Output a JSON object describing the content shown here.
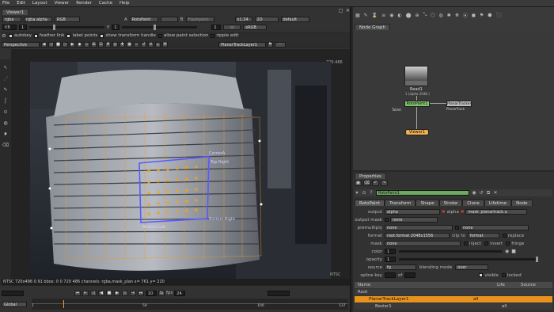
{
  "menu": [
    "File",
    "Edit",
    "Layout",
    "Viewer",
    "Render",
    "Cache",
    "Help"
  ],
  "viewer_tab": "Viewer1",
  "toolbar1": {
    "channels": "rgba",
    "layer": "rgba.alpha",
    "colorspace": "RGB",
    "a_label": "A",
    "a_input": "RotoPaint",
    "b_label": "B",
    "b_input": "Flashpoint",
    "zoom": "x1.34",
    "view_mode": "2D",
    "lut": "default"
  },
  "toolbar2": {
    "frame_field": "f/8",
    "range_a": "1",
    "y_label": "Y",
    "y_value": "1",
    "frame_num": "1",
    "lut2": "sRGB"
  },
  "roto_toolbar": {
    "autokey": "autokey",
    "feather_link": "feather link",
    "label_points": "label points",
    "show_handle": "show transform handle",
    "allow_paint": "allow paint selection",
    "ripple_edit": "ripple edit"
  },
  "tool_bar": {
    "view": "Perspective",
    "layer": "PlanarTrackLayer1"
  },
  "viewer": {
    "top_right_label": "720.486",
    "bottom_right_label": "NTSC",
    "status": "NTSC 720x486 0.91 bbox: 0 0 720 486 channels: rgba,mask_plan x= 761 y= 220",
    "corner_labels": [
      "CornerA",
      "Top Right",
      "Bottom Right",
      "Bottom Left"
    ]
  },
  "timeline": {
    "frame": "10",
    "fps_label": "fps",
    "fps": "24",
    "scope": "Global",
    "ticks": [
      "1",
      "50",
      "100",
      "137"
    ],
    "start": "1",
    "end": "137"
  },
  "node_graph": {
    "tab": "Node Graph",
    "nodes": {
      "read": "Read1",
      "read_sub": "1 (alpha 2048 )",
      "roto": "RotoPaint1",
      "roto_sub": "Tablet",
      "tracker": "PlanarTracker1",
      "tracker_sub": "PlanarTrack",
      "viewer": "Viewer1"
    }
  },
  "properties": {
    "tab": "Properties",
    "node_name": "RotoPaint1",
    "tabs": [
      "RotoPaint",
      "Transform",
      "Shape",
      "Stroke",
      "Clone",
      "Lifetime",
      "Node"
    ],
    "rows": [
      {
        "label": "output",
        "v1": "alpha",
        "v2": "alpha",
        "v3": "mask_planartrack.a"
      },
      {
        "label": "output mask",
        "v1": "none"
      },
      {
        "label": "premultiply",
        "v1": "none",
        "v2": "none"
      },
      {
        "label": "format",
        "v1": "root.format 2048x1556",
        "v2": "clip to",
        "v3": "format",
        "v4": "replace"
      },
      {
        "label": "mask",
        "v1": "none",
        "v2": "inject",
        "v3": "invert",
        "v4": "fringe"
      },
      {
        "label": "color",
        "v1": "1"
      },
      {
        "label": "opacity",
        "v1": "1"
      },
      {
        "label": "source",
        "v1": "fg",
        "v2": "blending mode",
        "v3": "over"
      },
      {
        "label": "spline key",
        "v1": "of",
        "v2": "visible",
        "v3": "locked"
      }
    ],
    "tree_headers": [
      "Name",
      "Life",
      "Source"
    ],
    "tree": [
      {
        "name": "Root"
      },
      {
        "name": "PlanarTrackLayer1",
        "life": "all"
      },
      {
        "name": "Bezier1",
        "life": "all"
      }
    ]
  },
  "colors": {
    "accent": "#f0a020",
    "selected_row": "#e8921e",
    "node_green": "#7ec36a",
    "viewer_node": "#f0b050",
    "panel_bg": "#323232",
    "spline_blue": "#5a5aff"
  }
}
